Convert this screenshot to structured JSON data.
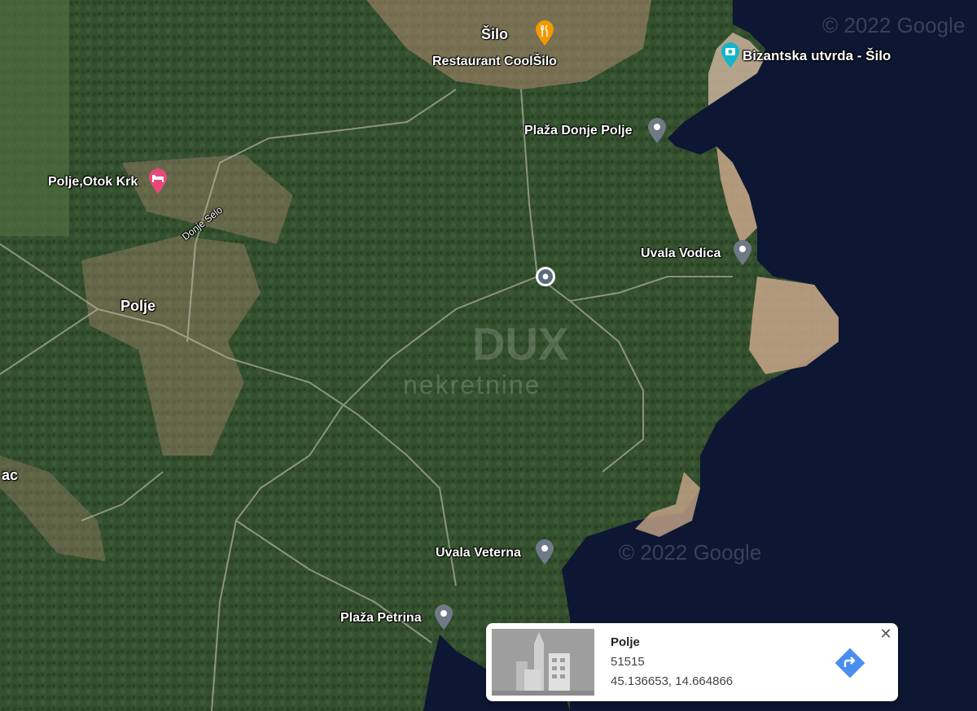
{
  "map": {
    "watermark_copyright": "© 2022 Google",
    "watermark_brand": "DUX",
    "watermark_brand_sub": "nekretnine",
    "colors": {
      "sea": "#0d1733",
      "forest": "#34502f",
      "land": "#c9a68a",
      "pin_gray": "#6f7a86",
      "pin_teal": "#12b5cb",
      "pin_orange": "#f29900",
      "pin_pink": "#e8497a",
      "direction": "#4a8ef0"
    }
  },
  "places": {
    "silo": "Šilo",
    "restaurant": "Restaurant CoolŠilo",
    "bizantska": "Bizantska utvrda - Šilo",
    "plaza_donje_polje": "Plaža Donje Polje",
    "polje_otok": "Polje,Otok Krk",
    "donje_selo": "Donje Selo",
    "uvala_vodica": "Uvala Vodica",
    "polje": "Polje",
    "ac": "ac",
    "uvala_veterna": "Uvala Veterna",
    "plaza_petrina": "Plaža Petrina"
  },
  "info_card": {
    "title": "Polje",
    "postal_code": "51515",
    "coordinates": "45.136653, 14.664866",
    "close_icon": "close-icon",
    "directions_icon": "directions-icon"
  }
}
